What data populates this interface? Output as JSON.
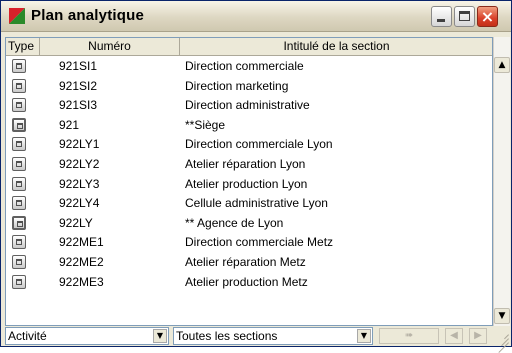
{
  "window": {
    "title": "Plan analytique"
  },
  "columns": [
    "Type",
    "Numéro",
    "Intitulé de la section"
  ],
  "rows": [
    {
      "type": "section-icon",
      "code": "921SI1",
      "label": "Direction commerciale"
    },
    {
      "type": "section-icon",
      "code": "921SI2",
      "label": "Direction marketing"
    },
    {
      "type": "section-icon",
      "code": "921SI3",
      "label": "Direction administrative"
    },
    {
      "type": "group-icon",
      "code": "921",
      "label": "**Siège"
    },
    {
      "type": "section-icon",
      "code": "922LY1",
      "label": "Direction commerciale Lyon"
    },
    {
      "type": "section-icon",
      "code": "922LY2",
      "label": "Atelier réparation Lyon"
    },
    {
      "type": "section-icon",
      "code": "922LY3",
      "label": "Atelier production Lyon"
    },
    {
      "type": "section-icon",
      "code": "922LY4",
      "label": "Cellule administrative Lyon"
    },
    {
      "type": "group-icon",
      "code": "922LY",
      "label": "** Agence de Lyon"
    },
    {
      "type": "section-icon",
      "code": "922ME1",
      "label": "Direction commerciale Metz"
    },
    {
      "type": "section-icon",
      "code": "922ME2",
      "label": "Atelier réparation Metz"
    },
    {
      "type": "section-icon",
      "code": "922ME3",
      "label": "Atelier production Metz"
    }
  ],
  "footer": {
    "filter_1": "Activité",
    "filter_2": "Toutes les sections"
  }
}
